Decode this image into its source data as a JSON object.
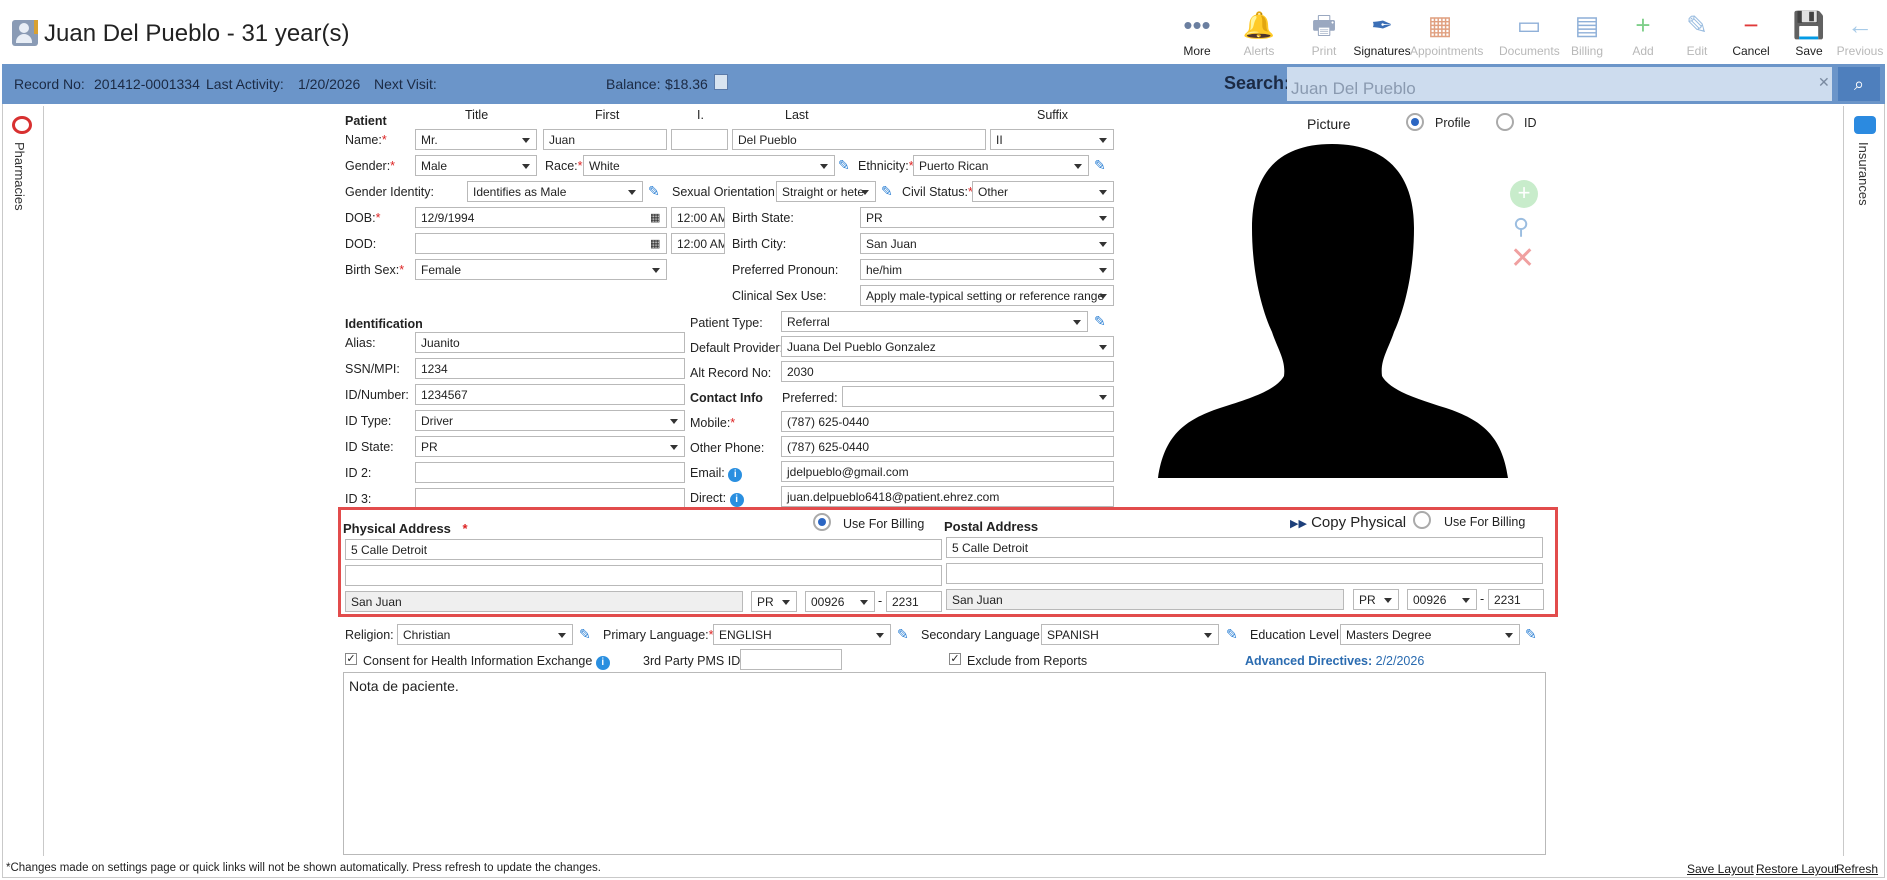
{
  "header": {
    "title": "Juan Del Pueblo - 31 year(s)"
  },
  "toolbar": [
    {
      "label": "More",
      "icon": "more-icon",
      "glyph": "•••",
      "color": "#6b7fa0",
      "enabled": true
    },
    {
      "label": "Alerts",
      "icon": "bell-icon",
      "glyph": "🔔",
      "color": "#f0c050",
      "enabled": false
    },
    {
      "label": "Print",
      "icon": "printer-icon",
      "glyph": "🖶",
      "color": "#9aa8c0",
      "enabled": false
    },
    {
      "label": "Signatures",
      "icon": "pen-nib-icon",
      "glyph": "✒",
      "color": "#3b6fb6",
      "enabled": true
    },
    {
      "label": "Appointments",
      "icon": "calendar-icon",
      "glyph": "▦",
      "color": "#e0a080",
      "enabled": false
    },
    {
      "label": "Documents",
      "icon": "tray-icon",
      "glyph": "▭",
      "color": "#8fb0d8",
      "enabled": false
    },
    {
      "label": "Billing",
      "icon": "billing-icon",
      "glyph": "▤",
      "color": "#8fb0d8",
      "enabled": false
    },
    {
      "label": "Add",
      "icon": "add-circle-icon",
      "glyph": "+",
      "color": "#7fcf8a",
      "enabled": false
    },
    {
      "label": "Edit",
      "icon": "pencil-icon",
      "glyph": "✎",
      "color": "#9bbde0",
      "enabled": false
    },
    {
      "label": "Cancel",
      "icon": "cancel-circle-icon",
      "glyph": "−",
      "color": "#e03a3a",
      "enabled": true
    },
    {
      "label": "Save",
      "icon": "floppy-icon",
      "glyph": "💾",
      "color": "#333",
      "enabled": true
    },
    {
      "label": "Previous",
      "icon": "arrow-left-icon",
      "glyph": "←",
      "color": "#a8cbe8",
      "enabled": false
    }
  ],
  "record_bar": {
    "record_label": "Record No:",
    "record_no": "201412-0001334",
    "last_activity_label": "Last Activity:",
    "last_activity": "1/20/2026",
    "next_visit_label": "Next Visit:",
    "balance_label": "Balance:",
    "balance": "$18.36",
    "search_label": "Search:",
    "search_value": "Juan Del Pueblo"
  },
  "side": {
    "left": "Pharmacies",
    "right": "Insurances"
  },
  "patient": {
    "section": "Patient",
    "col_title": "Title",
    "col_first": "First",
    "col_i": "I.",
    "col_last": "Last",
    "col_suffix": "Suffix",
    "name_label": "Name:",
    "title": "Mr.",
    "first": "Juan",
    "middle": "",
    "last": "Del Pueblo",
    "suffix": "II",
    "gender_label": "Gender:",
    "gender": "Male",
    "race_label": "Race:",
    "race": "White",
    "ethnicity_label": "Ethnicity:",
    "ethnicity": "Puerto Rican",
    "gender_identity_label": "Gender Identity:",
    "gender_identity": "Identifies as Male",
    "sexual_orientation_label": "Sexual Orientation:",
    "sexual_orientation": "Straight or hete",
    "civil_status_label": "Civil Status:",
    "civil_status": "Other",
    "dob_label": "DOB:",
    "dob": "12/9/1994",
    "dob_time": "12:00 AM",
    "birth_state_label": "Birth State:",
    "birth_state": "PR",
    "dod_label": "DOD:",
    "dod": "",
    "dod_time": "12:00 AM",
    "birth_city_label": "Birth City:",
    "birth_city": "San Juan",
    "birth_sex_label": "Birth Sex:",
    "birth_sex": "Female",
    "pronoun_label": "Preferred Pronoun:",
    "pronoun": "he/him",
    "clinical_sex_label": "Clinical Sex Use:",
    "clinical_sex": "Apply male-typical setting or reference range"
  },
  "identification": {
    "section": "Identification",
    "alias_label": "Alias:",
    "alias": "Juanito",
    "ssn_label": "SSN/MPI:",
    "ssn": "1234",
    "idnum_label": "ID/Number:",
    "idnum": "1234567",
    "idtype_label": "ID Type:",
    "idtype": "Driver",
    "idstate_label": "ID State:",
    "idstate": "PR",
    "id2_label": "ID 2:",
    "id2": "",
    "id3_label": "ID 3:",
    "id3": "",
    "patient_type_label": "Patient Type:",
    "patient_type": "Referral",
    "provider_label": "Default Provider:",
    "provider": "Juana Del Pueblo Gonzalez",
    "alt_record_label": "Alt Record No:",
    "alt_record": "2030",
    "contact_section": "Contact Info",
    "preferred_label": "Preferred:",
    "preferred": "",
    "mobile_label": "Mobile:",
    "mobile": "(787) 625-0440",
    "other_phone_label": "Other Phone:",
    "other_phone": "(787) 625-0440",
    "email_label": "Email:",
    "email": "jdelpueblo@gmail.com",
    "direct_label": "Direct:",
    "direct": "juan.delpueblo6418@patient.ehrez.com"
  },
  "picture": {
    "label": "Picture",
    "profile_label": "Profile",
    "id_label": "ID"
  },
  "physical": {
    "label": "Physical Address",
    "use_billing": "Use For Billing",
    "line1": "5 Calle Detroit",
    "line2": "",
    "city": "San Juan",
    "state": "PR",
    "zip": "00926",
    "zip4": "2231"
  },
  "postal": {
    "label": "Postal Address",
    "copy": "Copy Physical",
    "use_billing": "Use For Billing",
    "line1": "5 Calle Detroit",
    "line2": "",
    "city": "San Juan",
    "state": "PR",
    "zip": "00926",
    "zip4": "2231"
  },
  "extra": {
    "religion_label": "Religion:",
    "religion": "Christian",
    "primary_lang_label": "Primary Language:",
    "primary_lang": "ENGLISH",
    "secondary_lang_label": "Secondary Language:",
    "secondary_lang": "SPANISH",
    "education_label": "Education Level:",
    "education": "Masters Degree",
    "consent_label": "Consent for Health Information Exchange",
    "pms_label": "3rd Party PMS ID:",
    "pms": "",
    "exclude_label": "Exclude from Reports",
    "advanced_label": "Advanced Directives:",
    "advanced_date": "2/2/2026",
    "note": "Nota de paciente."
  },
  "footer": {
    "notice": "*Changes made on settings page or quick links will not be shown automatically. Press refresh to update the changes.",
    "save_layout": "Save Layout",
    "restore_layout": "Restore Layout",
    "refresh": "Refresh"
  }
}
